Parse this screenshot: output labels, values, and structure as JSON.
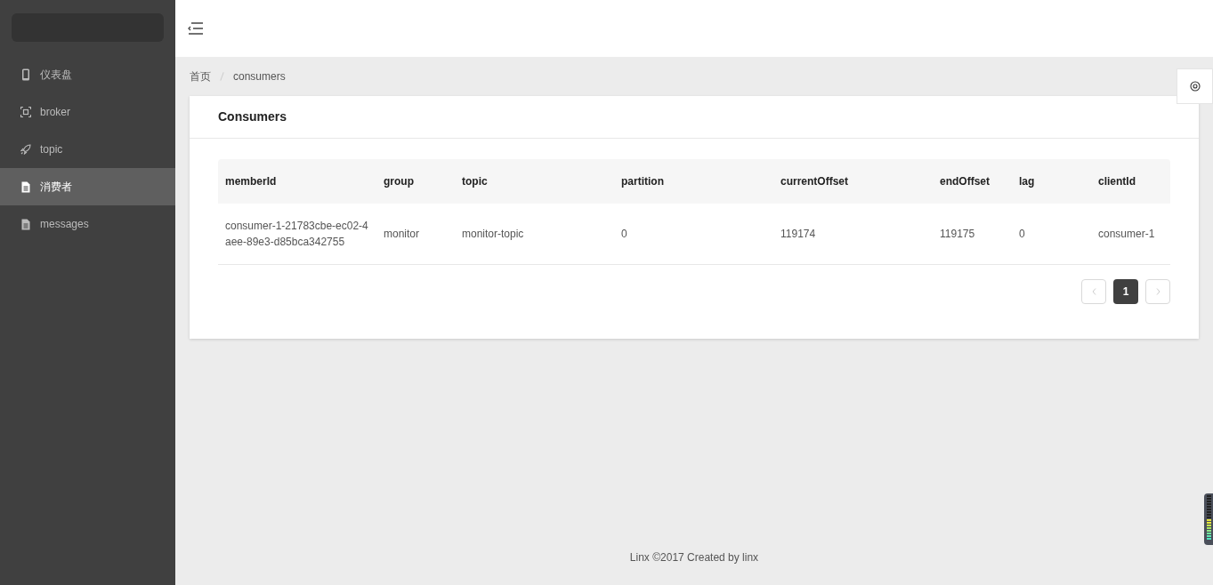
{
  "sidebar": {
    "items": [
      {
        "label": "仪表盘",
        "kind": "phone",
        "selected": false
      },
      {
        "label": "broker",
        "kind": "scan",
        "selected": false
      },
      {
        "label": "topic",
        "kind": "rocket",
        "selected": false
      },
      {
        "label": "消费者",
        "kind": "file",
        "selected": true
      },
      {
        "label": "messages",
        "kind": "file",
        "selected": false
      }
    ]
  },
  "breadcrumb": [
    "首页",
    "consumers"
  ],
  "card": {
    "title": "Consumers"
  },
  "table": {
    "columns": [
      "memberId",
      "group",
      "topic",
      "partition",
      "currentOffset",
      "endOffset",
      "lag",
      "clientId"
    ],
    "rows": [
      [
        "consumer-1-21783cbe-ec02-4aee-89e3-d85bca342755",
        "monitor",
        "monitor-topic",
        "0",
        "119174",
        "119175",
        "0",
        "consumer-1"
      ]
    ]
  },
  "pagination": {
    "pages": [
      {
        "label": "1",
        "selected": true
      }
    ]
  },
  "footer": "Linx ©2017 Created by linx"
}
